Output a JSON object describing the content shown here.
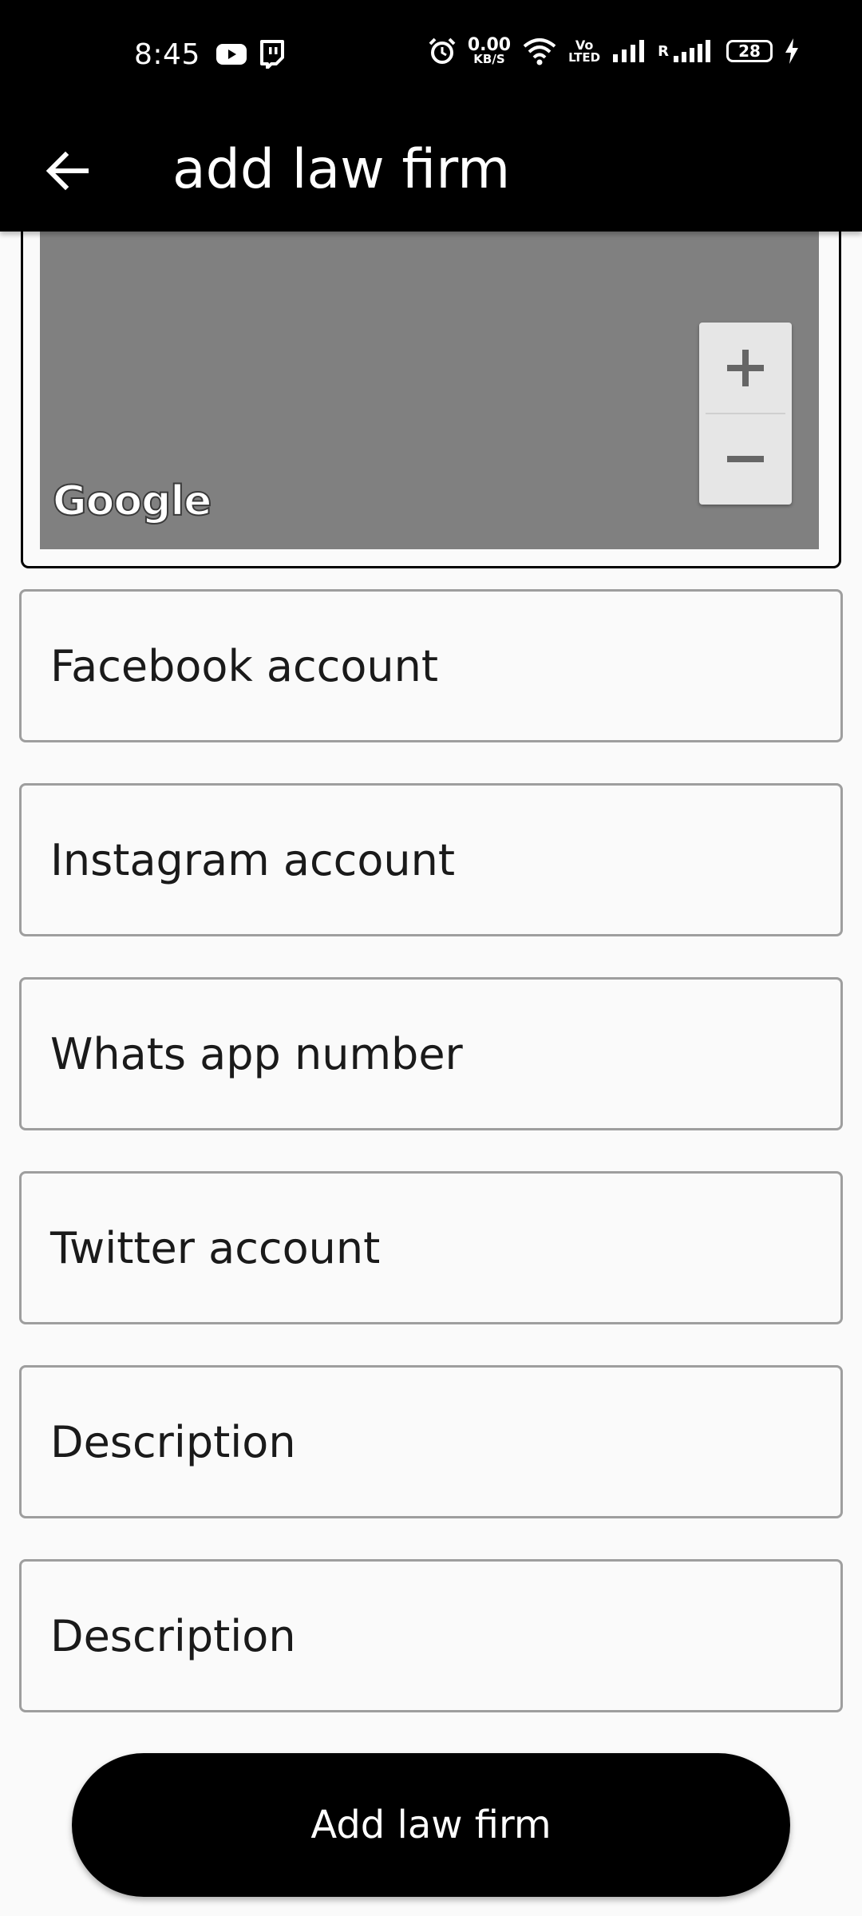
{
  "status_bar": {
    "time": "8:45",
    "net_speed_value": "0.00",
    "net_speed_unit": "KB/S",
    "volte_top": "Vo",
    "volte_bottom": "LTED",
    "roaming": "R",
    "battery": "28",
    "icons": [
      "youtube-icon",
      "twitch-icon",
      "alarm-icon",
      "wifi-icon",
      "signal-icon",
      "signal-icon",
      "battery-icon",
      "charging-icon"
    ]
  },
  "app_bar": {
    "title": "add law firm",
    "back_icon": "arrow-left-icon"
  },
  "map": {
    "logo": "Google",
    "zoom_in_icon": "plus-icon",
    "zoom_out_icon": "minus-icon"
  },
  "form": {
    "fields": [
      {
        "placeholder": "Facebook account"
      },
      {
        "placeholder": "Instagram account"
      },
      {
        "placeholder": "Whats app number"
      },
      {
        "placeholder": "Twitter account"
      },
      {
        "placeholder": "Description"
      },
      {
        "placeholder": "Description"
      }
    ],
    "submit_label": "Add law firm"
  },
  "colors": {
    "app_bar": "#000000",
    "background": "#fafafa",
    "map_fill": "#808080",
    "field_border": "#9e9e9e",
    "button": "#000000"
  }
}
